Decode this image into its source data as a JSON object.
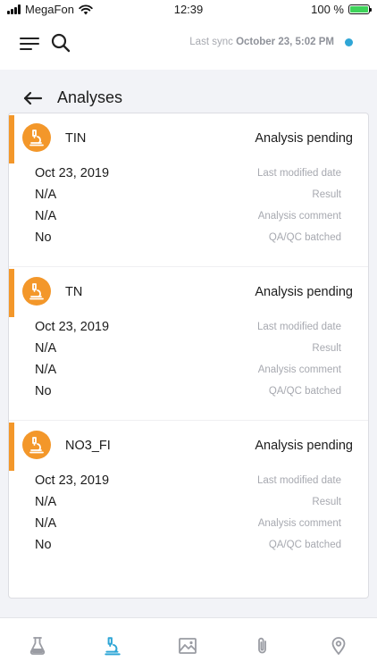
{
  "status_bar": {
    "carrier": "MegaFon",
    "time": "12:39",
    "battery": "100 %",
    "battery_level": 1.0
  },
  "header": {
    "sync_label": "Last sync",
    "sync_time": "October 23, 5:02 PM",
    "sync_indicator_color": "#2fa6d6"
  },
  "page": {
    "title": "Analyses"
  },
  "analyses": [
    {
      "name": "TIN",
      "status": "Analysis pending",
      "fields": [
        {
          "value": "Oct 23, 2019",
          "label": "Last modified date"
        },
        {
          "value": "N/A",
          "label": "Result"
        },
        {
          "value": "N/A",
          "label": "Analysis comment"
        },
        {
          "value": "No",
          "label": "QA/QC batched"
        }
      ]
    },
    {
      "name": "TN",
      "status": "Analysis pending",
      "fields": [
        {
          "value": "Oct 23, 2019",
          "label": "Last modified date"
        },
        {
          "value": "N/A",
          "label": "Result"
        },
        {
          "value": "N/A",
          "label": "Analysis comment"
        },
        {
          "value": "No",
          "label": "QA/QC batched"
        }
      ]
    },
    {
      "name": "NO3_FI",
      "status": "Analysis pending",
      "fields": [
        {
          "value": "Oct 23, 2019",
          "label": "Last modified date"
        },
        {
          "value": "N/A",
          "label": "Result"
        },
        {
          "value": "N/A",
          "label": "Analysis comment"
        },
        {
          "value": "No",
          "label": "QA/QC batched"
        }
      ]
    }
  ],
  "colors": {
    "accent": "#f3972a",
    "nav_active": "#2fa6d6",
    "nav_inactive": "#9a9ca3"
  },
  "bottom_nav": [
    {
      "icon": "flask-icon",
      "active": false
    },
    {
      "icon": "microscope-icon",
      "active": true
    },
    {
      "icon": "image-icon",
      "active": false
    },
    {
      "icon": "paperclip-icon",
      "active": false
    },
    {
      "icon": "location-pin-icon",
      "active": false
    }
  ]
}
